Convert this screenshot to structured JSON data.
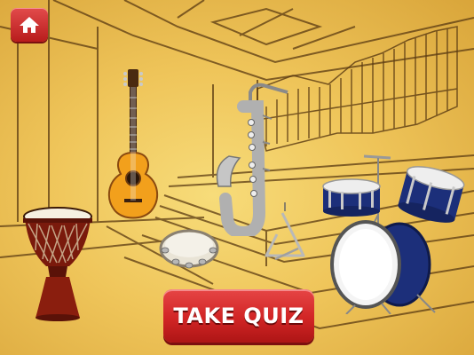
{
  "quiz_button": {
    "label": "TAKE QUIZ"
  },
  "icons": {
    "home": "home-icon"
  },
  "instruments": [
    "djembe",
    "guitar",
    "tambourine",
    "saxophone",
    "triangle",
    "drum-kit"
  ],
  "colors": {
    "button_red": "#d12525",
    "background": "#efc55a",
    "sketch_line": "#5a3a12"
  }
}
